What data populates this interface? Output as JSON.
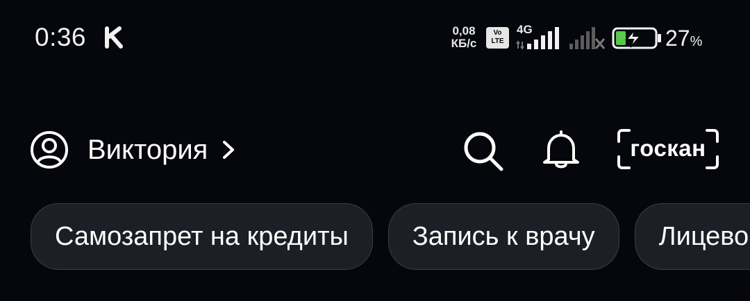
{
  "status_bar": {
    "time": "0:36",
    "app_icon": "k-letter-icon",
    "net_speed_value": "0,08",
    "net_speed_unit": "КБ/с",
    "volte_top": "Vo",
    "volte_bottom": "LTE",
    "network_type": "4G",
    "sim2_icon": "signal-no-service-icon",
    "battery_charging": true,
    "battery_percent": "27",
    "battery_percent_sign": "%",
    "battery_fill_color": "#5ac84b"
  },
  "header": {
    "avatar_icon": "user-circle-icon",
    "user_name": "Виктория",
    "chevron_icon": "chevron-right-icon",
    "search_icon": "search-icon",
    "notifications_icon": "bell-icon",
    "scan_label": "госкан"
  },
  "chips": [
    {
      "label": "Самозапрет на кредиты"
    },
    {
      "label": "Запись к врачу"
    },
    {
      "label": "Лицевой счёт"
    }
  ],
  "colors": {
    "background": "#05070c",
    "chip_background": "#1c1f26",
    "chip_border": "#3b3f47",
    "text": "#ffffff"
  }
}
